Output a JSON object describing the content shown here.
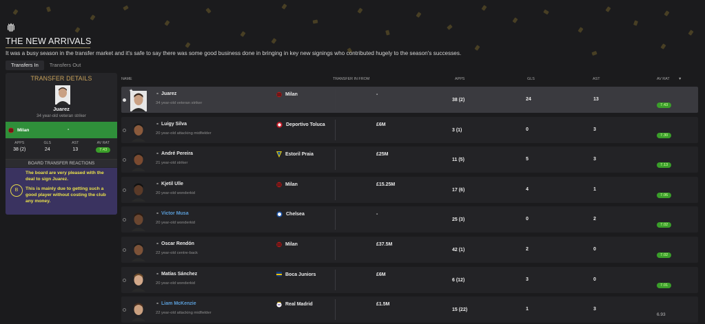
{
  "page": {
    "title": "THE NEW ARRIVALS",
    "subtitle": "It was a busy season in the transfer market and it's safe to say there was some good business done in bringing in key new signings who contributed hugely to the season's successes."
  },
  "tabs": [
    {
      "label": "Transfers In",
      "active": true
    },
    {
      "label": "Transfers Out",
      "active": false
    }
  ],
  "details": {
    "title": "TRANSFER DETAILS",
    "player_name": "Juarez",
    "player_desc": "34 year-old veteran striker",
    "club": "Milan",
    "fee": "-",
    "stat_headers": [
      "APPS",
      "GLS",
      "AST",
      "AV RAT"
    ],
    "stat_values": [
      "38 (2)",
      "24",
      "13",
      "7.43"
    ],
    "reactions_title": "BOARD TRANSFER REACTIONS",
    "grade": "B",
    "reaction_1": "The board are very pleased with the deal to sign Juarez.",
    "reaction_2": "This is mainly due to getting such a good player without costing the club any money."
  },
  "columns": {
    "name": "NAME",
    "from": "TRANSFER IN FROM",
    "apps": "APPS",
    "gls": "GLS",
    "ast": "AST",
    "rat": "AV RAT",
    "sort": "▼"
  },
  "rows": [
    {
      "name": "Juarez",
      "desc": "34 year-old veteran striker",
      "club": "Milan",
      "fee": "-",
      "apps": "38 (2)",
      "gls": "24",
      "ast": "13",
      "rating": "7.43"
    },
    {
      "name": "Luigy Silva",
      "desc": "20 year-old attacking midfielder",
      "club": "Deportivo Toluca",
      "fee": "£6M",
      "apps": "3 (1)",
      "gls": "0",
      "ast": "3",
      "rating": "7.30"
    },
    {
      "name": "André Pereira",
      "desc": "21 year-old striker",
      "club": "Estoril Praia",
      "fee": "£25M",
      "apps": "11 (5)",
      "gls": "5",
      "ast": "3",
      "rating": "7.13"
    },
    {
      "name": "Kjetil Ulle",
      "desc": "20 year-old wonderkid",
      "club": "Milan",
      "fee": "£15.25M",
      "apps": "17 (6)",
      "gls": "4",
      "ast": "1",
      "rating": "7.06"
    },
    {
      "name": "Victor Musa",
      "desc": "20 year-old wonderkid",
      "club": "Chelsea",
      "fee": "-",
      "apps": "25 (3)",
      "gls": "0",
      "ast": "2",
      "rating": "7.02"
    },
    {
      "name": "Oscar Rendón",
      "desc": "22 year-old centre-back",
      "club": "Milan",
      "fee": "£37.5M",
      "apps": "42 (1)",
      "gls": "2",
      "ast": "0",
      "rating": "7.02"
    },
    {
      "name": "Matías Sánchez",
      "desc": "20 year-old wonderkid",
      "club": "Boca Juniors",
      "fee": "£6M",
      "apps": "6 (12)",
      "gls": "3",
      "ast": "0",
      "rating": "7.01"
    },
    {
      "name": "Liam McKenzie",
      "desc": "22 year-old attacking midfielder",
      "club": "Real Madrid",
      "fee": "£1.5M",
      "apps": "15 (22)",
      "gls": "1",
      "ast": "3",
      "rating": "6.93"
    }
  ],
  "colors": {
    "accent_gold": "#c9a25a",
    "rating_green": "#3a9e2a",
    "club_green": "#2f8f3a",
    "reaction_purple": "#3a3360",
    "link_blue": "#5b9ed9"
  }
}
